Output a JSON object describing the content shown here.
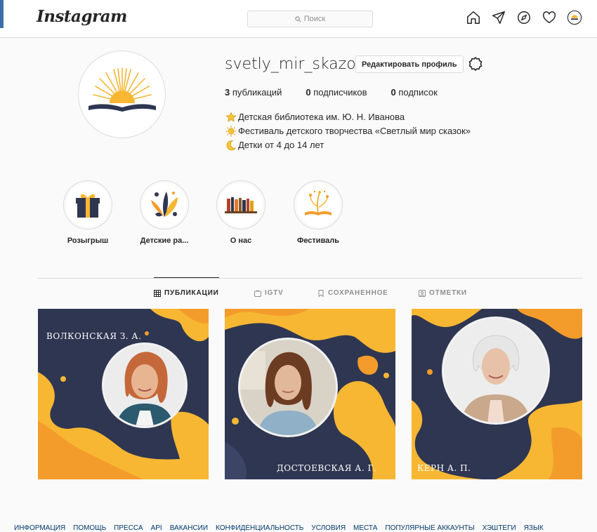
{
  "header": {
    "logo": "Instagram",
    "search_placeholder": "Поиск"
  },
  "profile": {
    "username": "svetly_mir_skazok",
    "edit_button": "Редактировать профиль",
    "stats": [
      {
        "count": "3",
        "label": " публикаций"
      },
      {
        "count": "0",
        "label": " подписчиков"
      },
      {
        "count": "0",
        "label": " подписок"
      }
    ],
    "bio": [
      {
        "icon": "star-icon",
        "text": "Детская библиотека им. Ю. Н. Иванова"
      },
      {
        "icon": "sun-icon",
        "text": "Фестиваль детского творчества «Светлый мир сказок»"
      },
      {
        "icon": "moon-icon",
        "text": "Детки от 4 до 14 лет"
      }
    ]
  },
  "highlights": [
    {
      "label": "Розыгрыш",
      "icon": "gift-icon"
    },
    {
      "label": "Детские ра...",
      "icon": "leaves-icon"
    },
    {
      "label": "О нас",
      "icon": "books-icon"
    },
    {
      "label": "Фестиваль",
      "icon": "book-sparkle-icon"
    }
  ],
  "tabs": [
    {
      "label": "ПУБЛИКАЦИИ",
      "icon": "grid-icon",
      "active": true
    },
    {
      "label": "IGTV",
      "icon": "igtv-icon",
      "active": false
    },
    {
      "label": "СОХРАНЕННОЕ",
      "icon": "bookmark-icon",
      "active": false
    },
    {
      "label": "ОТМЕТКИ",
      "icon": "tag-icon",
      "active": false
    }
  ],
  "posts": [
    {
      "caption": "ВОЛКОНСКАЯ З. А."
    },
    {
      "caption": "ДОСТОЕВСКАЯ А. Г."
    },
    {
      "caption": "КЕРН А. П."
    }
  ],
  "footer": [
    "ИНФОРМАЦИЯ",
    "ПОМОЩЬ",
    "ПРЕССА",
    "API",
    "ВАКАНСИИ",
    "КОНФИДЕНЦИАЛЬНОСТЬ",
    "УСЛОВИЯ",
    "МЕСТА",
    "ПОПУЛЯРНЫЕ АККАУНТЫ",
    "ХЭШТЕГИ",
    "ЯЗЫК"
  ],
  "colors": {
    "navy": "#2f3651",
    "yellow": "#f7b733",
    "orange": "#f39c2b",
    "link": "#00376b"
  }
}
